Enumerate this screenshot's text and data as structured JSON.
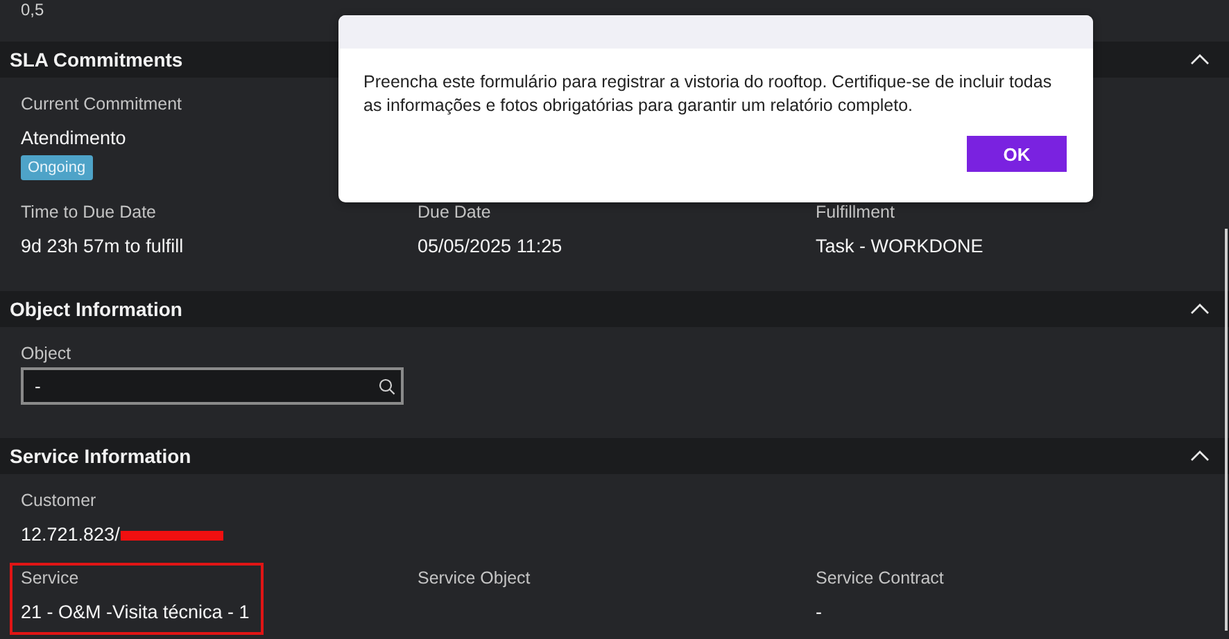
{
  "top_value": "0,5",
  "sections": [
    {
      "title": "SLA Commitments",
      "expanded": true,
      "rows": [
        [
          {
            "kind": "text",
            "label": "Current Commitment",
            "value": "Atendimento",
            "badge": "Ongoing"
          }
        ],
        [
          {
            "kind": "text",
            "label": "Time to Due Date",
            "value": "9d 23h 57m to fulfill"
          },
          {
            "kind": "text",
            "label": "Due Date",
            "value": "05/05/2025 11:25"
          },
          {
            "kind": "text",
            "label": "Fulfillment",
            "value": "Task - WORKDONE"
          }
        ]
      ]
    },
    {
      "title": "Object Information",
      "expanded": true,
      "rows": [
        [
          {
            "kind": "search",
            "label": "Object",
            "value": "-"
          }
        ]
      ]
    },
    {
      "title": "Service Information",
      "expanded": true,
      "rows": [
        [
          {
            "kind": "text",
            "label": "Customer",
            "value": "12.721.823/",
            "redacted": true
          }
        ],
        [
          {
            "kind": "text",
            "label": "Service",
            "value": "21 - O&M -Visita técnica - 1",
            "highlighted": true
          },
          {
            "kind": "text",
            "label": "Service Object"
          },
          {
            "kind": "text",
            "label": "Service Contract",
            "value": "-"
          }
        ]
      ]
    }
  ],
  "dialog": {
    "message": "Preencha este formulário para registrar a vistoria do rooftop. Certifique-se de incluir todas as informações e fotos obrigatórias para garantir um relatório completo.",
    "button": "OK"
  }
}
